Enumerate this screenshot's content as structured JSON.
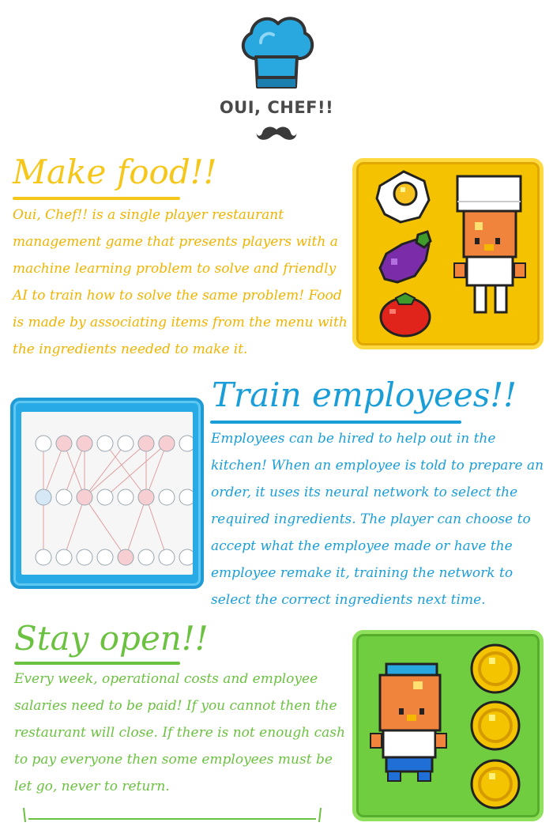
{
  "header": {
    "brand": "OUI, CHEF!!",
    "logo_icon": "chef-hat-icon",
    "mustache_icon": "mustache-icon"
  },
  "sections": [
    {
      "title": "Make food!!",
      "body": "Oui, Chef!! is a single player restaurant management game that presents players with a machine learning problem to solve and friendly AI to train how to solve the same problem! Food is made by associating items from the menu with the ingredients needed to make it.",
      "color": "#f5c71a",
      "panel_items": [
        "fried-egg-icon",
        "eggplant-icon",
        "tomato-icon",
        "chef-character-icon"
      ]
    },
    {
      "title": "Train employees!!",
      "body": "Employees can be hired to help out in the kitchen! When an employee is told to prepare an order, it uses its neural network to select the required ingredients. The player can choose to accept what the employee made or have the employee remake it, training the network to select the correct ingredients next time.",
      "color": "#1a9ed8",
      "panel_items": [
        "neural-network-diagram"
      ]
    },
    {
      "title": "Stay open!!",
      "body": "Every week, operational costs and employee salaries need to be paid! If you cannot then the restaurant will close. If there is not enough cash to pay everyone then some employees must be let go, never to return.",
      "color": "#6bc140",
      "panel_items": [
        "employee-character-icon",
        "gold-coin-icon",
        "gold-coin-icon",
        "gold-coin-icon"
      ]
    }
  ]
}
